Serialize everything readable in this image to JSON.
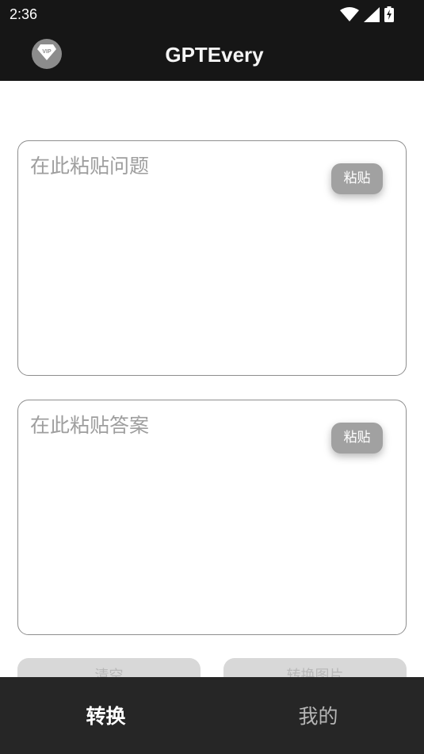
{
  "status_bar": {
    "time": "2:36",
    "icons": [
      "wifi-icon",
      "signal-icon",
      "battery-charging-icon"
    ]
  },
  "app_bar": {
    "title": "GPTEvery",
    "vip_badge": "VIP",
    "vip_icon": "vip-diamond-icon"
  },
  "question_box": {
    "placeholder": "在此粘贴问题",
    "value": "",
    "paste_label": "粘贴"
  },
  "answer_box": {
    "placeholder": "在此粘贴答案",
    "value": "",
    "paste_label": "粘贴"
  },
  "actions": {
    "clear_label": "清空",
    "convert_label": "转换图片"
  },
  "bottom_nav": {
    "items": [
      {
        "label": "转换",
        "selected": true
      },
      {
        "label": "我的",
        "selected": false
      }
    ]
  },
  "colors": {
    "app_bar": "#161616",
    "bottom_nav": "#262626",
    "paste_button": "#a1a1a1",
    "disabled_button": "#d8d8d8",
    "border": "#8e8e8e"
  }
}
